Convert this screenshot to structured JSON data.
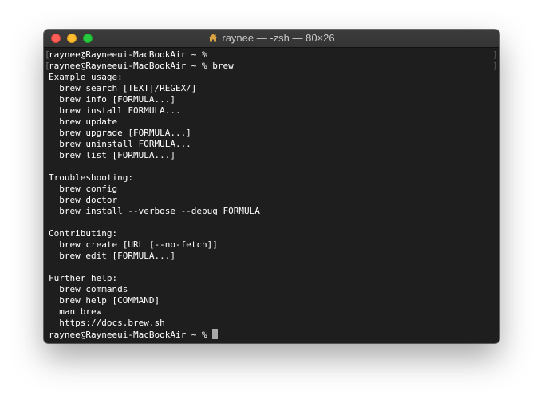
{
  "window": {
    "title": "raynee — -zsh — 80×26"
  },
  "terminal": {
    "lines": [
      "raynee@Rayneeui-MacBookAir ~ %",
      "raynee@Rayneeui-MacBookAir ~ % brew",
      "Example usage:",
      "  brew search [TEXT|/REGEX/]",
      "  brew info [FORMULA...]",
      "  brew install FORMULA...",
      "  brew update",
      "  brew upgrade [FORMULA...]",
      "  brew uninstall FORMULA...",
      "  brew list [FORMULA...]",
      "",
      "Troubleshooting:",
      "  brew config",
      "  brew doctor",
      "  brew install --verbose --debug FORMULA",
      "",
      "Contributing:",
      "  brew create [URL [--no-fetch]]",
      "  brew edit [FORMULA...]",
      "",
      "Further help:",
      "  brew commands",
      "  brew help [COMMAND]",
      "  man brew",
      "  https://docs.brew.sh"
    ],
    "prompt": "raynee@Rayneeui-MacBookAir ~ % ",
    "cursor_color": "#a8a8a8",
    "background_color": "#1e1e1e",
    "text_color": "#ffffff"
  }
}
